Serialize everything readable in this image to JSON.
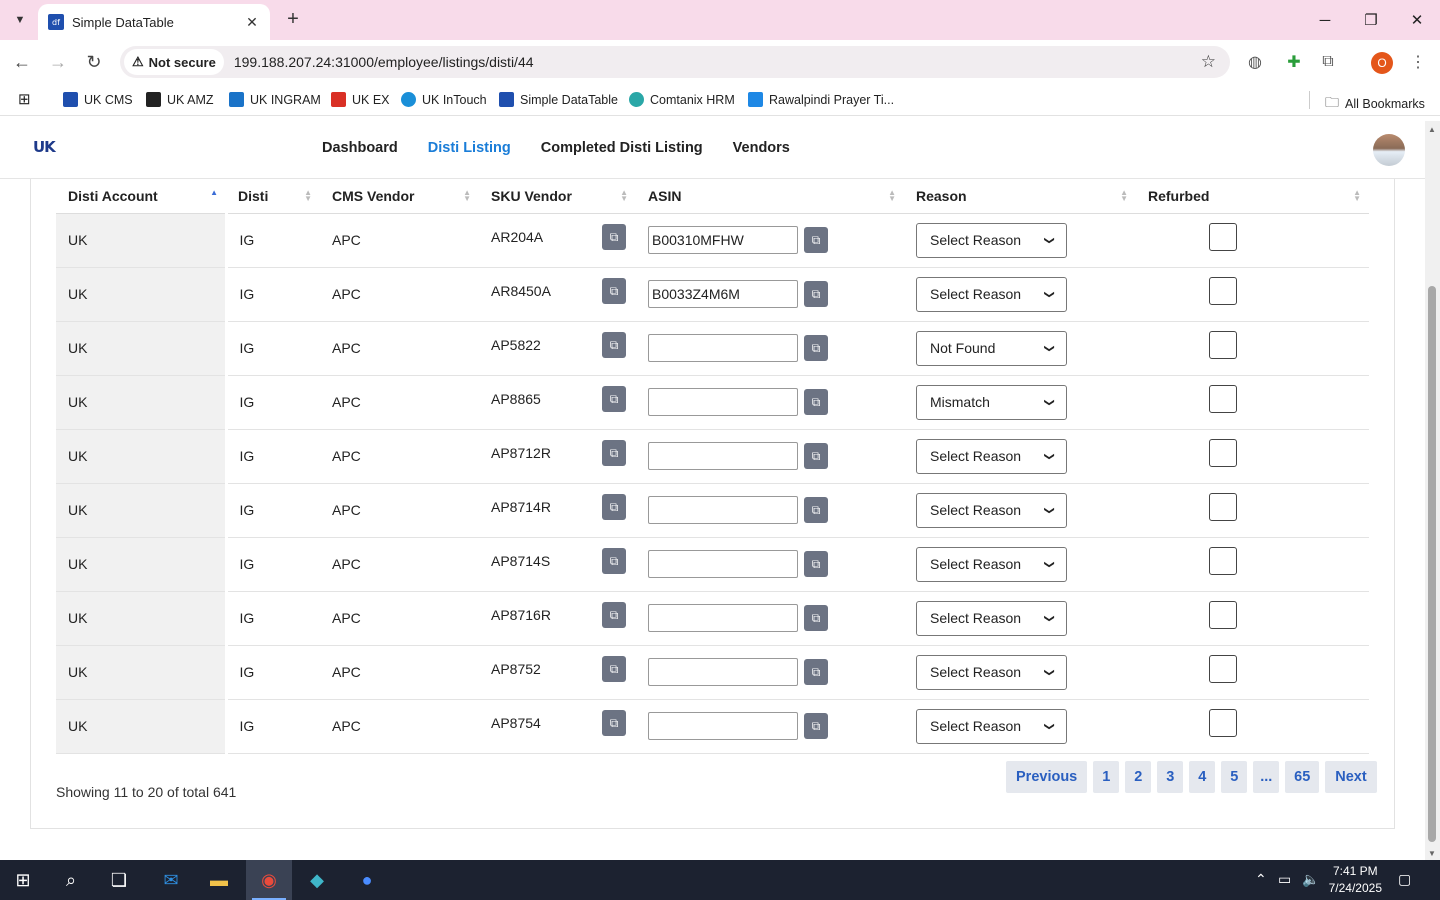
{
  "browser": {
    "tab_title": "Simple DataTable",
    "tab_favicon": "df",
    "security_label": "Not secure",
    "url": "199.188.207.24:31000/employee/listings/disti/44",
    "profile_initial": "O",
    "bookmarks": [
      {
        "label": "UK CMS",
        "icon": "df-icon",
        "color": "#1f4fae"
      },
      {
        "label": "UK AMZ",
        "icon": "amazon-icon",
        "color": "#222222"
      },
      {
        "label": "UK INGRAM",
        "icon": "ingram-icon",
        "color": "#1a73c8"
      },
      {
        "label": "UK EX",
        "icon": "ex-icon",
        "color": "#d93025"
      },
      {
        "label": "UK InTouch",
        "icon": "intouch-icon",
        "color": "#1a8fd8"
      },
      {
        "label": "Simple DataTable",
        "icon": "df-icon",
        "color": "#1f4fae"
      },
      {
        "label": "Comtanix HRM",
        "icon": "hrm-icon",
        "color": "#2aa7a7"
      },
      {
        "label": "Rawalpindi Prayer Ti...",
        "icon": "prayer-icon",
        "color": "#1e88e5"
      }
    ],
    "all_bookmarks": "All Bookmarks"
  },
  "app": {
    "logo": "UK",
    "nav": [
      "Dashboard",
      "Disti Listing",
      "Completed Disti Listing",
      "Vendors"
    ],
    "active_nav": "Disti Listing"
  },
  "table": {
    "columns": [
      "Disti Account",
      "Disti",
      "CMS Vendor",
      "SKU Vendor",
      "ASIN",
      "Reason",
      "Refurbed"
    ],
    "rows": [
      {
        "account": "UK",
        "disti": "IG",
        "vendor": "APC",
        "sku": "AR204A",
        "asin": "B00310MFHW",
        "reason": "Select Reason",
        "refurbed": false
      },
      {
        "account": "UK",
        "disti": "IG",
        "vendor": "APC",
        "sku": "AR8450A",
        "asin": "B0033Z4M6M",
        "reason": "Select Reason",
        "refurbed": false
      },
      {
        "account": "UK",
        "disti": "IG",
        "vendor": "APC",
        "sku": "AP5822",
        "asin": "",
        "reason": "Not Found",
        "refurbed": false
      },
      {
        "account": "UK",
        "disti": "IG",
        "vendor": "APC",
        "sku": "AP8865",
        "asin": "",
        "reason": "Mismatch",
        "refurbed": false
      },
      {
        "account": "UK",
        "disti": "IG",
        "vendor": "APC",
        "sku": "AP8712R",
        "asin": "",
        "reason": "Select Reason",
        "refurbed": false
      },
      {
        "account": "UK",
        "disti": "IG",
        "vendor": "APC",
        "sku": "AP8714R",
        "asin": "",
        "reason": "Select Reason",
        "refurbed": false
      },
      {
        "account": "UK",
        "disti": "IG",
        "vendor": "APC",
        "sku": "AP8714S",
        "asin": "",
        "reason": "Select Reason",
        "refurbed": false
      },
      {
        "account": "UK",
        "disti": "IG",
        "vendor": "APC",
        "sku": "AP8716R",
        "asin": "",
        "reason": "Select Reason",
        "refurbed": false
      },
      {
        "account": "UK",
        "disti": "IG",
        "vendor": "APC",
        "sku": "AP8752",
        "asin": "",
        "reason": "Select Reason",
        "refurbed": false
      },
      {
        "account": "UK",
        "disti": "IG",
        "vendor": "APC",
        "sku": "AP8754",
        "asin": "",
        "reason": "Select Reason",
        "refurbed": false
      }
    ]
  },
  "footer": {
    "showing": "Showing 11 to 20 of total 641",
    "pages": [
      "Previous",
      "1",
      "2",
      "3",
      "4",
      "5",
      "...",
      "65",
      "Next"
    ]
  },
  "taskbar": {
    "time": "7:41 PM",
    "date": "7/24/2025"
  }
}
